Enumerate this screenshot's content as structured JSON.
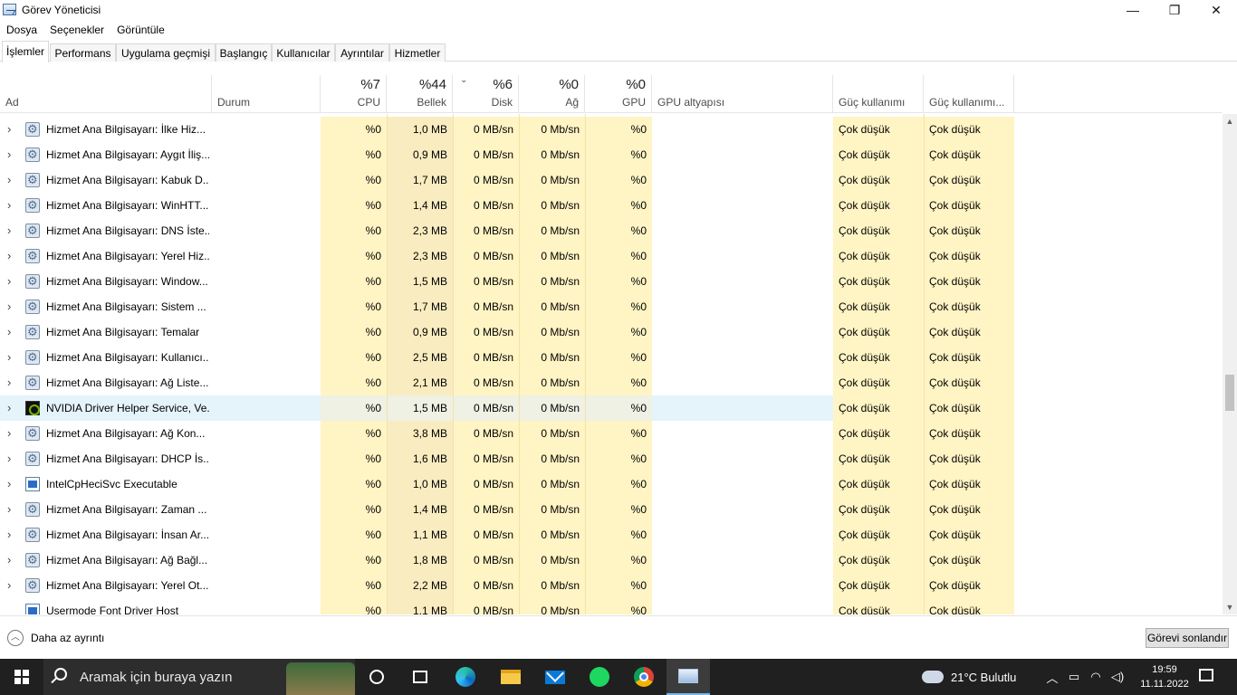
{
  "window": {
    "title": "Görev Yöneticisi",
    "minimize": "—",
    "maximize": "❐",
    "close": "✕"
  },
  "menu": [
    "Dosya",
    "Seçenekler",
    "Görüntüle"
  ],
  "tabs": [
    "İşlemler",
    "Performans",
    "Uygulama geçmişi",
    "Başlangıç",
    "Kullanıcılar",
    "Ayrıntılar",
    "Hizmetler"
  ],
  "header": {
    "name": "Ad",
    "status": "Durum",
    "cpu_pct": "%7",
    "cpu": "CPU",
    "mem_pct": "%44",
    "mem": "Bellek",
    "disk_pct": "%6",
    "disk": "Disk",
    "net_pct": "%0",
    "net": "Ağ",
    "gpu_pct": "%0",
    "gpu": "GPU",
    "gpu_engine": "GPU altyapısı",
    "power": "Güç kullanımı",
    "power_trend": "Güç kullanımı..."
  },
  "rows": [
    {
      "icon": "gear-icon",
      "name": "Hizmet Ana Bilgisayarı: İlke Hiz...",
      "cpu": "%0",
      "mem": "1,0 MB",
      "disk": "0 MB/sn",
      "net": "0 Mb/sn",
      "gpu": "%0",
      "power": "Çok düşük",
      "power_trend": "Çok düşük"
    },
    {
      "icon": "gear-icon",
      "name": "Hizmet Ana Bilgisayarı: Aygıt İliş...",
      "cpu": "%0",
      "mem": "0,9 MB",
      "disk": "0 MB/sn",
      "net": "0 Mb/sn",
      "gpu": "%0",
      "power": "Çok düşük",
      "power_trend": "Çok düşük"
    },
    {
      "icon": "gear-icon",
      "name": "Hizmet Ana Bilgisayarı: Kabuk D...",
      "cpu": "%0",
      "mem": "1,7 MB",
      "disk": "0 MB/sn",
      "net": "0 Mb/sn",
      "gpu": "%0",
      "power": "Çok düşük",
      "power_trend": "Çok düşük"
    },
    {
      "icon": "gear-icon",
      "name": "Hizmet Ana Bilgisayarı: WinHTT...",
      "cpu": "%0",
      "mem": "1,4 MB",
      "disk": "0 MB/sn",
      "net": "0 Mb/sn",
      "gpu": "%0",
      "power": "Çok düşük",
      "power_trend": "Çok düşük"
    },
    {
      "icon": "gear-icon",
      "name": "Hizmet Ana Bilgisayarı: DNS İste...",
      "cpu": "%0",
      "mem": "2,3 MB",
      "disk": "0 MB/sn",
      "net": "0 Mb/sn",
      "gpu": "%0",
      "power": "Çok düşük",
      "power_trend": "Çok düşük"
    },
    {
      "icon": "gear-icon",
      "name": "Hizmet Ana Bilgisayarı: Yerel Hiz...",
      "cpu": "%0",
      "mem": "2,3 MB",
      "disk": "0 MB/sn",
      "net": "0 Mb/sn",
      "gpu": "%0",
      "power": "Çok düşük",
      "power_trend": "Çok düşük"
    },
    {
      "icon": "gear-icon",
      "name": "Hizmet Ana Bilgisayarı: Window...",
      "cpu": "%0",
      "mem": "1,5 MB",
      "disk": "0 MB/sn",
      "net": "0 Mb/sn",
      "gpu": "%0",
      "power": "Çok düşük",
      "power_trend": "Çok düşük"
    },
    {
      "icon": "gear-icon",
      "name": "Hizmet Ana Bilgisayarı: Sistem ...",
      "cpu": "%0",
      "mem": "1,7 MB",
      "disk": "0 MB/sn",
      "net": "0 Mb/sn",
      "gpu": "%0",
      "power": "Çok düşük",
      "power_trend": "Çok düşük"
    },
    {
      "icon": "gear-icon",
      "name": "Hizmet Ana Bilgisayarı: Temalar",
      "cpu": "%0",
      "mem": "0,9 MB",
      "disk": "0 MB/sn",
      "net": "0 Mb/sn",
      "gpu": "%0",
      "power": "Çok düşük",
      "power_trend": "Çok düşük"
    },
    {
      "icon": "gear-icon",
      "name": "Hizmet Ana Bilgisayarı: Kullanıcı...",
      "cpu": "%0",
      "mem": "2,5 MB",
      "disk": "0 MB/sn",
      "net": "0 Mb/sn",
      "gpu": "%0",
      "power": "Çok düşük",
      "power_trend": "Çok düşük"
    },
    {
      "icon": "gear-icon",
      "name": "Hizmet Ana Bilgisayarı: Ağ Liste...",
      "cpu": "%0",
      "mem": "2,1 MB",
      "disk": "0 MB/sn",
      "net": "0 Mb/sn",
      "gpu": "%0",
      "power": "Çok düşük",
      "power_trend": "Çok düşük"
    },
    {
      "icon": "nvidia-icon",
      "name": "NVIDIA Driver Helper Service, Ve...",
      "cpu": "%0",
      "mem": "1,5 MB",
      "disk": "0 MB/sn",
      "net": "0 Mb/sn",
      "gpu": "%0",
      "power": "Çok düşük",
      "power_trend": "Çok düşük",
      "selected": true
    },
    {
      "icon": "gear-icon",
      "name": "Hizmet Ana Bilgisayarı: Ağ Kon...",
      "cpu": "%0",
      "mem": "3,8 MB",
      "disk": "0 MB/sn",
      "net": "0 Mb/sn",
      "gpu": "%0",
      "power": "Çok düşük",
      "power_trend": "Çok düşük"
    },
    {
      "icon": "gear-icon",
      "name": "Hizmet Ana Bilgisayarı: DHCP İs...",
      "cpu": "%0",
      "mem": "1,6 MB",
      "disk": "0 MB/sn",
      "net": "0 Mb/sn",
      "gpu": "%0",
      "power": "Çok düşük",
      "power_trend": "Çok düşük"
    },
    {
      "icon": "window-app-icon",
      "name": "IntelCpHeciSvc Executable",
      "cpu": "%0",
      "mem": "1,0 MB",
      "disk": "0 MB/sn",
      "net": "0 Mb/sn",
      "gpu": "%0",
      "power": "Çok düşük",
      "power_trend": "Çok düşük"
    },
    {
      "icon": "gear-icon",
      "name": "Hizmet Ana Bilgisayarı: Zaman ...",
      "cpu": "%0",
      "mem": "1,4 MB",
      "disk": "0 MB/sn",
      "net": "0 Mb/sn",
      "gpu": "%0",
      "power": "Çok düşük",
      "power_trend": "Çok düşük"
    },
    {
      "icon": "gear-icon",
      "name": "Hizmet Ana Bilgisayarı: İnsan Ar...",
      "cpu": "%0",
      "mem": "1,1 MB",
      "disk": "0 MB/sn",
      "net": "0 Mb/sn",
      "gpu": "%0",
      "power": "Çok düşük",
      "power_trend": "Çok düşük"
    },
    {
      "icon": "gear-icon",
      "name": "Hizmet Ana Bilgisayarı: Ağ Bağl...",
      "cpu": "%0",
      "mem": "1,8 MB",
      "disk": "0 MB/sn",
      "net": "0 Mb/sn",
      "gpu": "%0",
      "power": "Çok düşük",
      "power_trend": "Çok düşük"
    },
    {
      "icon": "gear-icon",
      "name": "Hizmet Ana Bilgisayarı: Yerel Ot...",
      "cpu": "%0",
      "mem": "2,2 MB",
      "disk": "0 MB/sn",
      "net": "0 Mb/sn",
      "gpu": "%0",
      "power": "Çok düşük",
      "power_trend": "Çok düşük"
    },
    {
      "icon": "window-app-icon",
      "name": "Usermode Font Driver Host",
      "cpu": "%0",
      "mem": "1,1 MB",
      "disk": "0 MB/sn",
      "net": "0 Mb/sn",
      "gpu": "%0",
      "power": "Çok düşük",
      "power_trend": "Çok düşük",
      "no_expander": true
    }
  ],
  "footer": {
    "fewer_details": "Daha az ayrıntı",
    "end_task": "Görevi sonlandır"
  },
  "taskbar": {
    "search_placeholder": "Aramak için buraya yazın",
    "weather": "21°C  Bulutlu",
    "time": "19:59",
    "date": "11.11.2022"
  }
}
